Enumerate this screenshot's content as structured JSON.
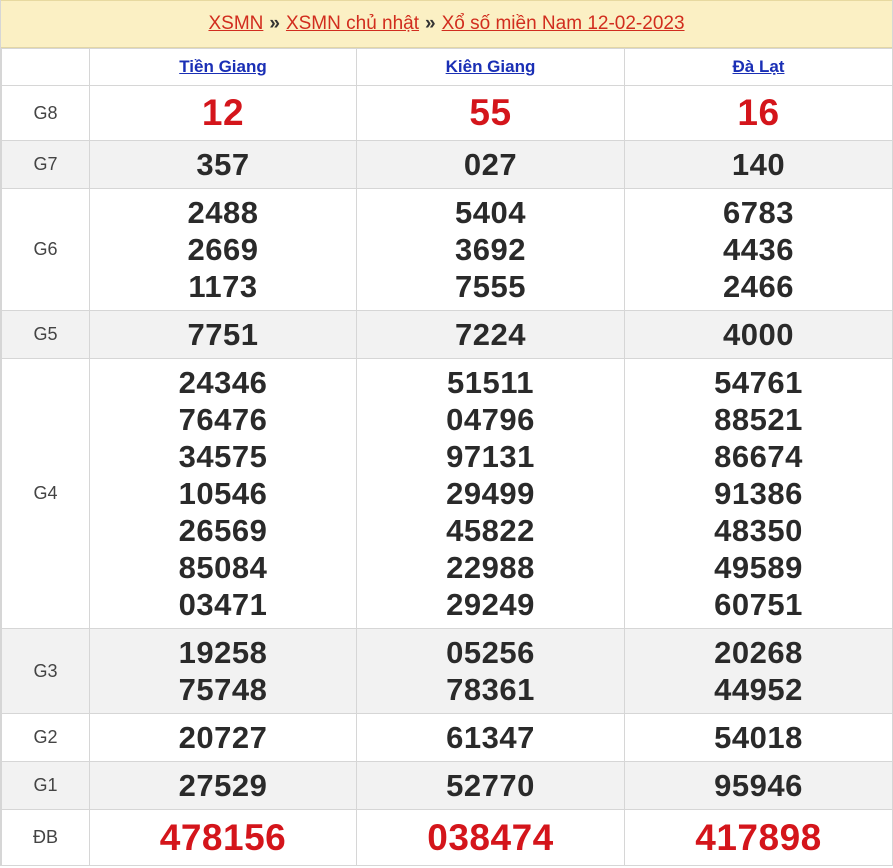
{
  "breadcrumb": {
    "link1": "XSMN",
    "sep": "»",
    "link2": "XSMN chủ nhật",
    "link3": "Xổ số miền Nam 12-02-2023"
  },
  "provinces": [
    "Tiền Giang",
    "Kiên Giang",
    "Đà Lạt"
  ],
  "prizes": [
    {
      "label": "G8",
      "cols": [
        [
          "12"
        ],
        [
          "55"
        ],
        [
          "16"
        ]
      ]
    },
    {
      "label": "G7",
      "cols": [
        [
          "357"
        ],
        [
          "027"
        ],
        [
          "140"
        ]
      ]
    },
    {
      "label": "G6",
      "cols": [
        [
          "2488",
          "2669",
          "1173"
        ],
        [
          "5404",
          "3692",
          "7555"
        ],
        [
          "6783",
          "4436",
          "2466"
        ]
      ]
    },
    {
      "label": "G5",
      "cols": [
        [
          "7751"
        ],
        [
          "7224"
        ],
        [
          "4000"
        ]
      ]
    },
    {
      "label": "G4",
      "cols": [
        [
          "24346",
          "76476",
          "34575",
          "10546",
          "26569",
          "85084",
          "03471"
        ],
        [
          "51511",
          "04796",
          "97131",
          "29499",
          "45822",
          "22988",
          "29249"
        ],
        [
          "54761",
          "88521",
          "86674",
          "91386",
          "48350",
          "49589",
          "60751"
        ]
      ]
    },
    {
      "label": "G3",
      "cols": [
        [
          "19258",
          "75748"
        ],
        [
          "05256",
          "78361"
        ],
        [
          "20268",
          "44952"
        ]
      ]
    },
    {
      "label": "G2",
      "cols": [
        [
          "20727"
        ],
        [
          "61347"
        ],
        [
          "54018"
        ]
      ]
    },
    {
      "label": "G1",
      "cols": [
        [
          "27529"
        ],
        [
          "52770"
        ],
        [
          "95946"
        ]
      ]
    },
    {
      "label": "ĐB",
      "cols": [
        [
          "478156"
        ],
        [
          "038474"
        ],
        [
          "417898"
        ]
      ]
    }
  ]
}
